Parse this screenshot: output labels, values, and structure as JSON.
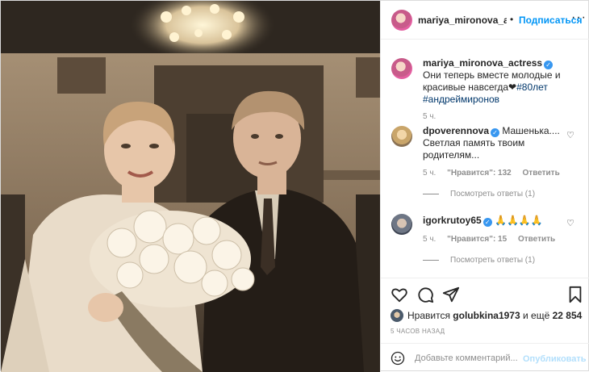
{
  "header": {
    "username": "mariya_mironova_a",
    "separator": "•",
    "follow_label": "Подписаться",
    "more_label": "···"
  },
  "caption": {
    "username": "mariya_mironova_actress",
    "text": "Они теперь вместе молодые и красивые навсегда❤",
    "hashtags": "#80лет #андреймиронов",
    "time": "5 ч."
  },
  "comments": [
    {
      "username": "dpoverennova",
      "text": "Машенька.... Светлая память твоим родителям...",
      "time": "5 ч.",
      "likes": "\"Нравится\": 132",
      "reply_label": "Ответить",
      "view_replies": "Посмотреть ответы (1)"
    },
    {
      "username": "igorkrutoy65",
      "text": "🙏🙏🙏🙏",
      "time": "5 ч.",
      "likes": "\"Нравится\": 15",
      "reply_label": "Ответить",
      "view_replies": "Посмотреть ответы (1)"
    }
  ],
  "likes": {
    "prefix": "Нравится",
    "user": "golubkina1973",
    "middle": "и ещё",
    "count": "22 854"
  },
  "timestamp": "5 ЧАСОВ НАЗАД",
  "add_comment": {
    "placeholder": "Добавьте комментарий...",
    "publish_label": "Опубликовать"
  },
  "icons": {
    "heart": "heart-icon",
    "comment": "comment-icon",
    "share": "share-icon",
    "bookmark": "bookmark-icon",
    "emoji": "emoji-icon",
    "verified": "verified-icon"
  },
  "colors": {
    "link_blue": "#0095f6",
    "verified_blue": "#3897f0",
    "muted": "#8e8e8e",
    "hashtag": "#00376b"
  }
}
